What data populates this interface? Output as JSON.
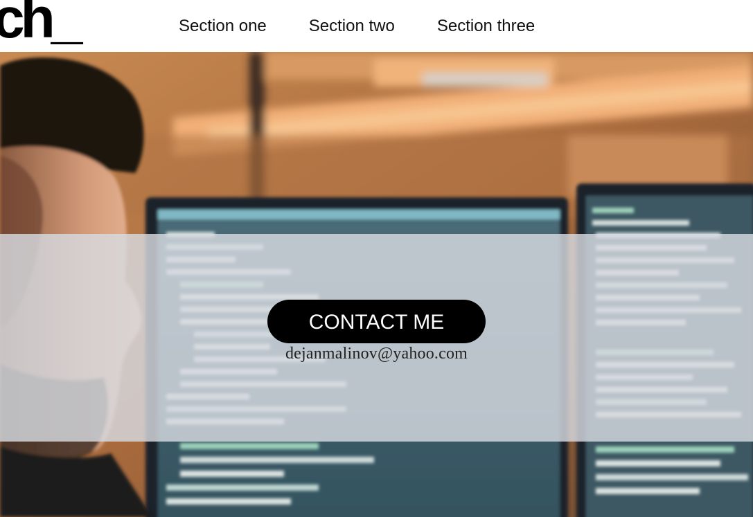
{
  "header": {
    "logo_text": "ch_",
    "nav": [
      {
        "label": "Section one"
      },
      {
        "label": "Section two"
      },
      {
        "label": "Section three"
      }
    ]
  },
  "hero": {
    "image_icon": "developer-at-monitors-photo",
    "cta_label": "CONTACT ME",
    "email": "dejanmalinov@yahoo.com"
  },
  "colors": {
    "header_bg": "#ffffff",
    "nav_text": "#111111",
    "button_bg": "#000000",
    "button_text": "#ffffff",
    "overlay": "#d7dbe1"
  }
}
